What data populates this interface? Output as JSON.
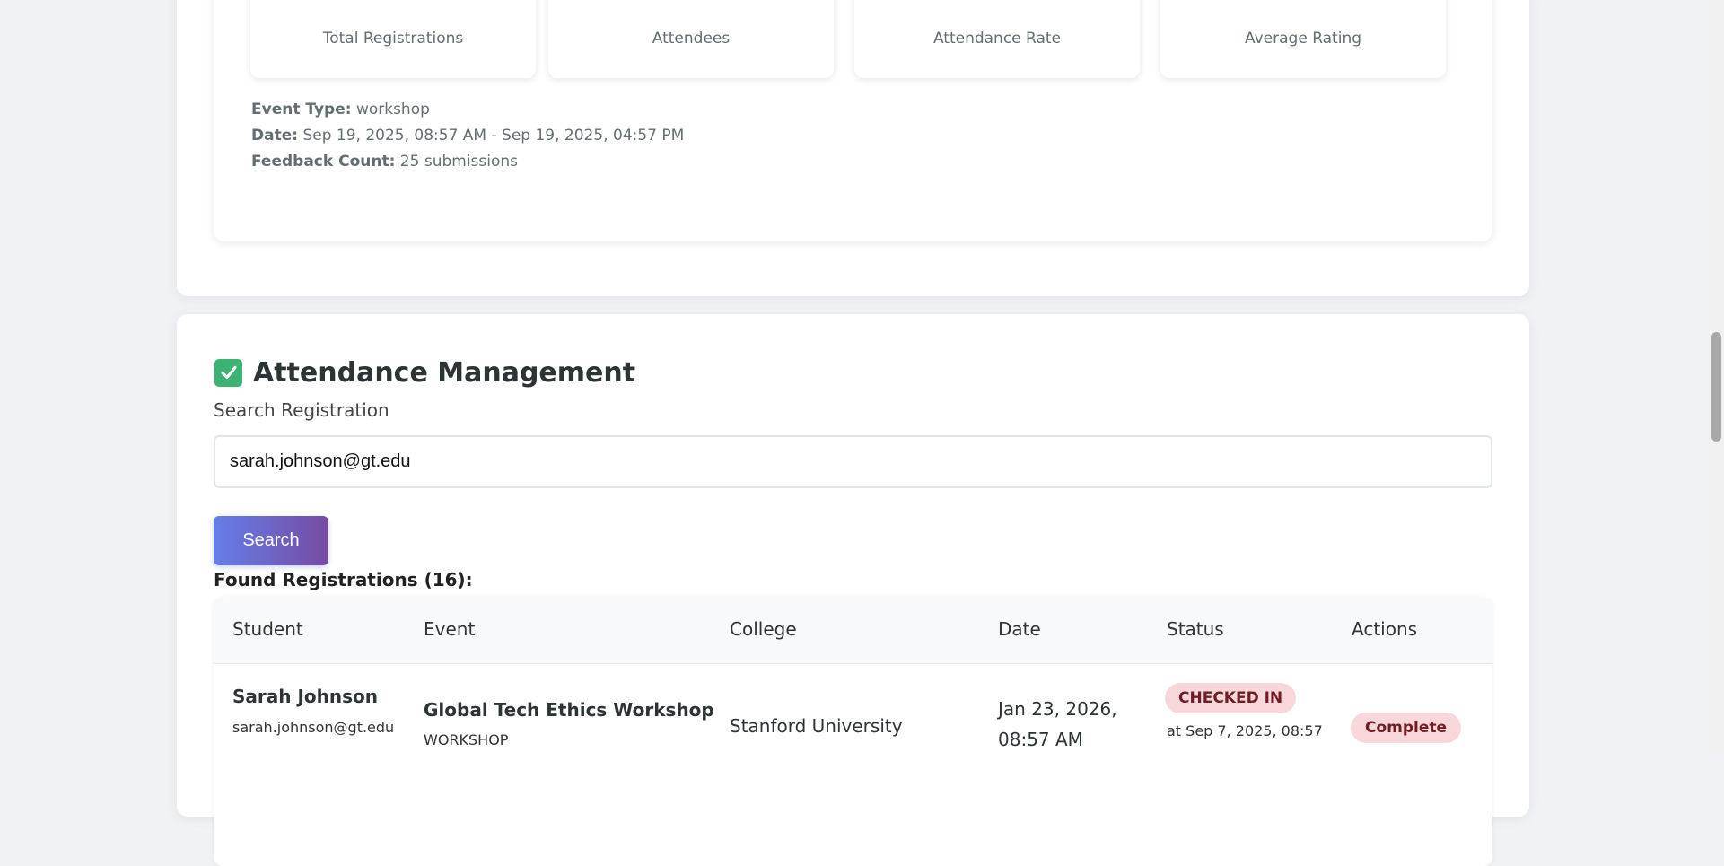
{
  "stats": [
    {
      "label": "Total Registrations"
    },
    {
      "label": "Attendees"
    },
    {
      "label": "Attendance Rate"
    },
    {
      "label": "Average Rating"
    }
  ],
  "event_info": {
    "type_label": "Event Type:",
    "type_value": "workshop",
    "date_label": "Date:",
    "date_value": "Sep 19, 2025, 08:57 AM - Sep 19, 2025, 04:57 PM",
    "feedback_label": "Feedback Count:",
    "feedback_value": "25 submissions"
  },
  "attendance": {
    "title": "Attendance Management",
    "search_label": "Search Registration",
    "search_value": "sarah.johnson@gt.edu",
    "search_button": "Search",
    "found_text": "Found Registrations (16):"
  },
  "table": {
    "headers": [
      "Student",
      "Event",
      "College",
      "Date",
      "Status",
      "Actions"
    ],
    "rows": [
      {
        "student_name": "Sarah Johnson",
        "student_email": "sarah.johnson@gt.edu",
        "event_name": "Global Tech Ethics Workshop",
        "event_type": "WORKSHOP",
        "college": "Stanford University",
        "date_line1": "Jan 23, 2026,",
        "date_line2": "08:57 AM",
        "status": "CHECKED IN",
        "status_time": "at Sep 7, 2025, 08:57",
        "action": "Complete"
      }
    ]
  },
  "colors": {
    "accent": "#667eea",
    "accent_end": "#764ba2",
    "status_bg": "#f8d7da",
    "status_text": "#721c24"
  }
}
